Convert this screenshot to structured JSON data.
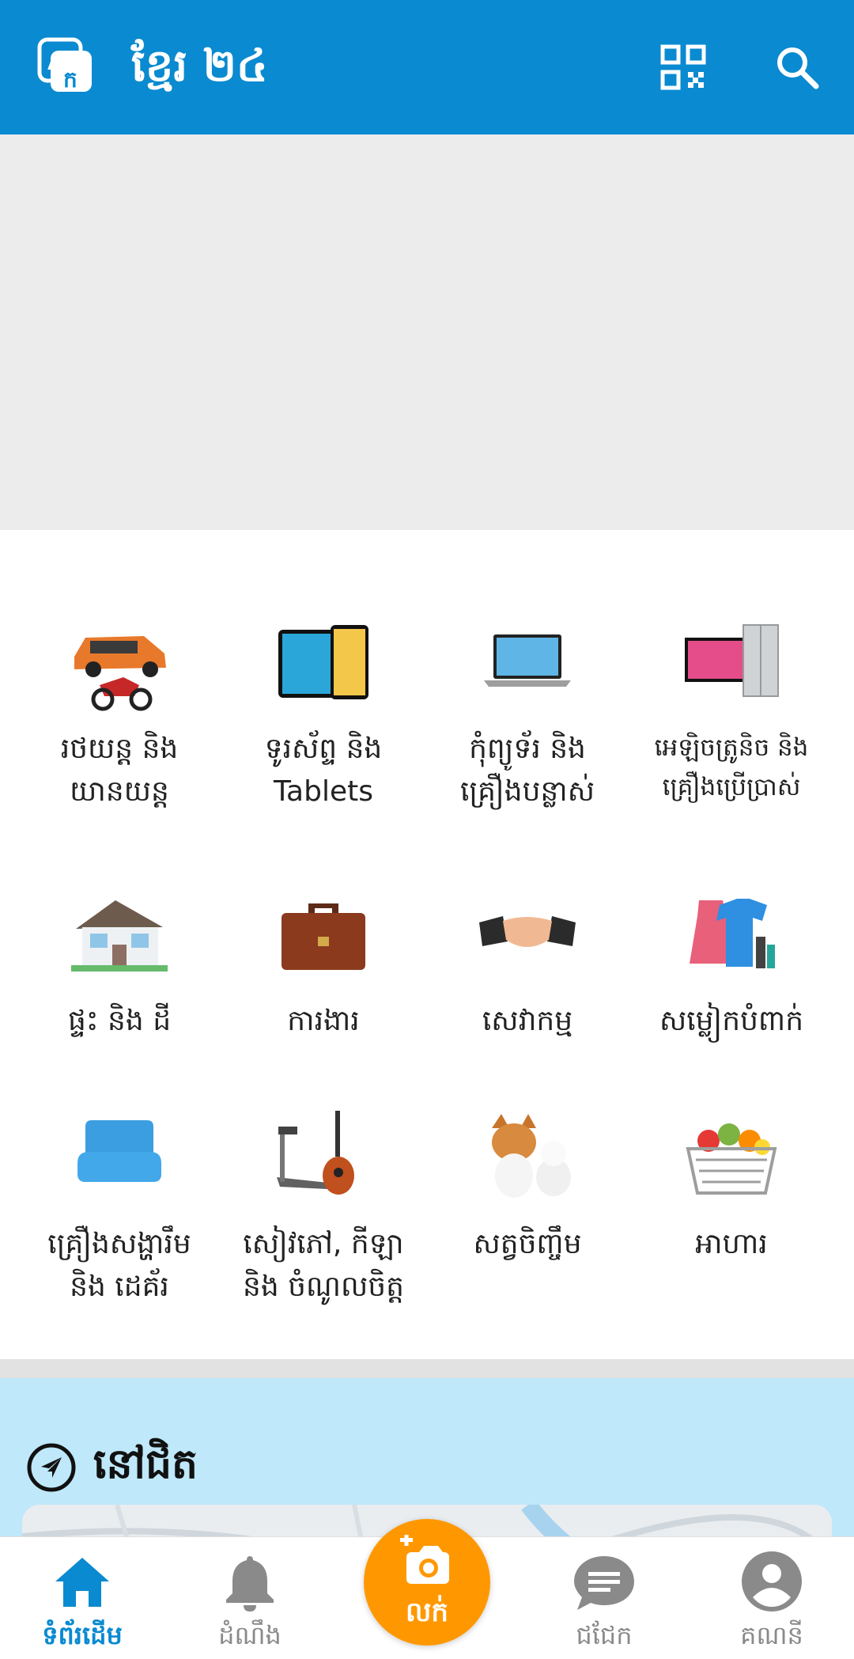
{
  "header": {
    "title": "ខ្មែរ ២៤",
    "icons": [
      "app-logo-icon",
      "qr-code-icon",
      "search-icon"
    ],
    "color": "#0a8ad0"
  },
  "categories": [
    {
      "label": "រថយន្ត និង\nយានយន្ត",
      "icon": "car-motorbike-icon"
    },
    {
      "label": "ទូរស័ព្ទ និង\nTablets",
      "icon": "phone-tablet-icon"
    },
    {
      "label": "កុំព្យូទ័រ និង\nគ្រឿងបន្លាស់",
      "icon": "laptop-icon"
    },
    {
      "label": "អេឡិចត្រូនិច និង\nគ្រឿងប្រើប្រាស់",
      "icon": "electronics-icon"
    },
    {
      "label": "ផ្ទះ និង ដី",
      "icon": "house-icon"
    },
    {
      "label": "ការងារ",
      "icon": "briefcase-icon"
    },
    {
      "label": "សេវាកម្ម",
      "icon": "handshake-icon"
    },
    {
      "label": "សម្លៀកបំពាក់",
      "icon": "clothing-icon"
    },
    {
      "label": "គ្រឿងសង្ហារឹម\nនិង ដេគ័រ",
      "icon": "sofa-icon"
    },
    {
      "label": "សៀវភៅ, កីឡា\nនិង ចំណូលចិត្ត",
      "icon": "sports-hobby-icon"
    },
    {
      "label": "សត្វចិញ្ចឹម",
      "icon": "pets-icon"
    },
    {
      "label": "អាហារ",
      "icon": "food-basket-icon"
    }
  ],
  "nearby": {
    "title": "នៅជិត",
    "icon": "navigation-arrow-icon"
  },
  "bottom_nav": {
    "home": "ទំព័រដើម",
    "notifications": "ដំណឹង",
    "sell": "លក់",
    "chat": "ជជែក",
    "account": "គណនី"
  },
  "colors": {
    "accent": "#0a8ad0",
    "sell": "#ff9800",
    "nearby_bg": "#bfe8fa"
  }
}
